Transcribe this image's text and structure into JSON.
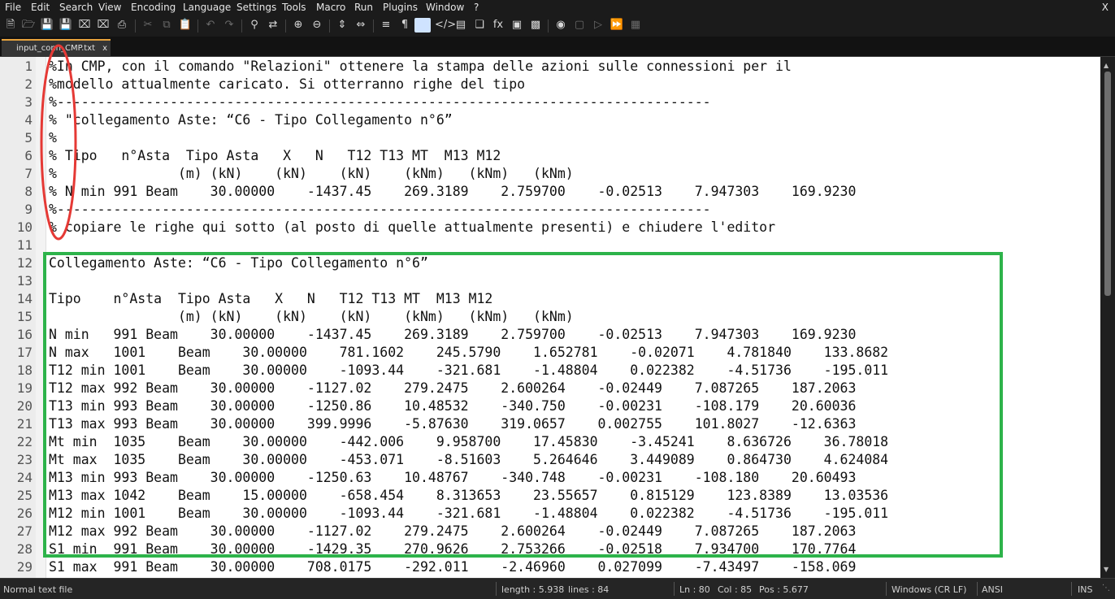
{
  "menu": {
    "items": [
      "File",
      "Edit",
      "Search",
      "View",
      "Encoding",
      "Language",
      "Settings",
      "Tools",
      "Macro",
      "Run",
      "Plugins",
      "Window",
      "?"
    ],
    "close": "X"
  },
  "toolbar": {
    "buttons": [
      "new-file",
      "open-file",
      "save",
      "save-all",
      "close",
      "close-all",
      "print",
      "cut",
      "copy",
      "paste",
      "undo",
      "redo",
      "find",
      "replace",
      "zoom-in",
      "zoom-out",
      "sync-vertical",
      "sync-horizontal",
      "word-wrap",
      "show-all-characters",
      "indent-guide",
      "xml-tag",
      "document-map",
      "document-list",
      "function-list",
      "monitoring",
      "project-panel",
      "record-macro",
      "stop-recording",
      "playback-macro",
      "run-macro-multiple",
      "save-macro"
    ]
  },
  "tab": {
    "label": "input_conn_CMP.txt",
    "close": "x"
  },
  "editor": {
    "lines": [
      {
        "n": "1",
        "text": "%In CMP, con il comando \"Relazioni\" ottenere la stampa delle azioni sulle connessioni per il"
      },
      {
        "n": "2",
        "text": "%modello attualmente caricato. Si otterranno righe del tipo"
      },
      {
        "n": "3",
        "text": "%---------------------------------------------------------------------------------"
      },
      {
        "n": "4",
        "text": "% \"collegamento Aste: “C6 - Tipo Collegamento n°6”"
      },
      {
        "n": "5",
        "text": "%"
      },
      {
        "n": "6",
        "text": "% Tipo   n°Asta  Tipo Asta   X   N   T12 T13 MT  M13 M12"
      },
      {
        "n": "7",
        "text": "%               (m) (kN)    (kN)    (kN)    (kNm)   (kNm)   (kNm)"
      },
      {
        "n": "8",
        "text": "% N min 991 Beam    30.00000    -1437.45    269.3189    2.759700    -0.02513    7.947303    169.9230"
      },
      {
        "n": "9",
        "text": "%---------------------------------------------------------------------------------"
      },
      {
        "n": "10",
        "text": "% copiare le righe qui sotto (al posto di quelle attualmente presenti) e chiudere l'editor"
      },
      {
        "n": "11",
        "text": ""
      },
      {
        "n": "12",
        "text": "Collegamento Aste: “C6 - Tipo Collegamento n°6”"
      },
      {
        "n": "13",
        "text": ""
      },
      {
        "n": "14",
        "text": "Tipo    n°Asta  Tipo Asta   X   N   T12 T13 MT  M13 M12"
      },
      {
        "n": "15",
        "text": "                (m) (kN)    (kN)    (kN)    (kNm)   (kNm)   (kNm)"
      },
      {
        "n": "16",
        "text": "N min   991 Beam    30.00000    -1437.45    269.3189    2.759700    -0.02513    7.947303    169.9230"
      },
      {
        "n": "17",
        "text": "N max   1001    Beam    30.00000    781.1602    245.5790    1.652781    -0.02071    4.781840    133.8682"
      },
      {
        "n": "18",
        "text": "T12 min 1001    Beam    30.00000    -1093.44    -321.681    -1.48804    0.022382    -4.51736    -195.011"
      },
      {
        "n": "19",
        "text": "T12 max 992 Beam    30.00000    -1127.02    279.2475    2.600264    -0.02449    7.087265    187.2063"
      },
      {
        "n": "20",
        "text": "T13 min 993 Beam    30.00000    -1250.86    10.48532    -340.750    -0.00231    -108.179    20.60036"
      },
      {
        "n": "21",
        "text": "T13 max 993 Beam    30.00000    399.9996    -5.87630    319.0657    0.002755    101.8027    -12.6363"
      },
      {
        "n": "22",
        "text": "Mt min  1035    Beam    30.00000    -442.006    9.958700    17.45830    -3.45241    8.636726    36.78018"
      },
      {
        "n": "23",
        "text": "Mt max  1035    Beam    30.00000    -453.071    -8.51603    5.264646    3.449089    0.864730    4.624084"
      },
      {
        "n": "24",
        "text": "M13 min 993 Beam    30.00000    -1250.63    10.48767    -340.748    -0.00231    -108.180    20.60493"
      },
      {
        "n": "25",
        "text": "M13 max 1042    Beam    15.00000    -658.454    8.313653    23.55657    0.815129    123.8389    13.03536"
      },
      {
        "n": "26",
        "text": "M12 min 1001    Beam    30.00000    -1093.44    -321.681    -1.48804    0.022382    -4.51736    -195.011"
      },
      {
        "n": "27",
        "text": "M12 max 992 Beam    30.00000    -1127.02    279.2475    2.600264    -0.02449    7.087265    187.2063"
      },
      {
        "n": "28",
        "text": "S1 min  991 Beam    30.00000    -1429.35    270.9626    2.753266    -0.02518    7.934700    170.7764"
      },
      {
        "n": "29",
        "text": "S1 max  991 Beam    30.00000    708.0175    -292.011    -2.46960    0.027099    -7.43497    -158.069"
      }
    ]
  },
  "statusbar": {
    "file_type": "Normal text file",
    "length": "length : 5.938",
    "lines": "lines : 84",
    "ln": "Ln : 80",
    "col": "Col : 85",
    "pos": "Pos : 5.677",
    "eol": "Windows (CR LF)",
    "encoding": "ANSI",
    "mode": "INS"
  },
  "colors": {
    "red_annotation": "#e53935",
    "green_annotation": "#2db34a",
    "tab_accent": "#e8a33d"
  }
}
